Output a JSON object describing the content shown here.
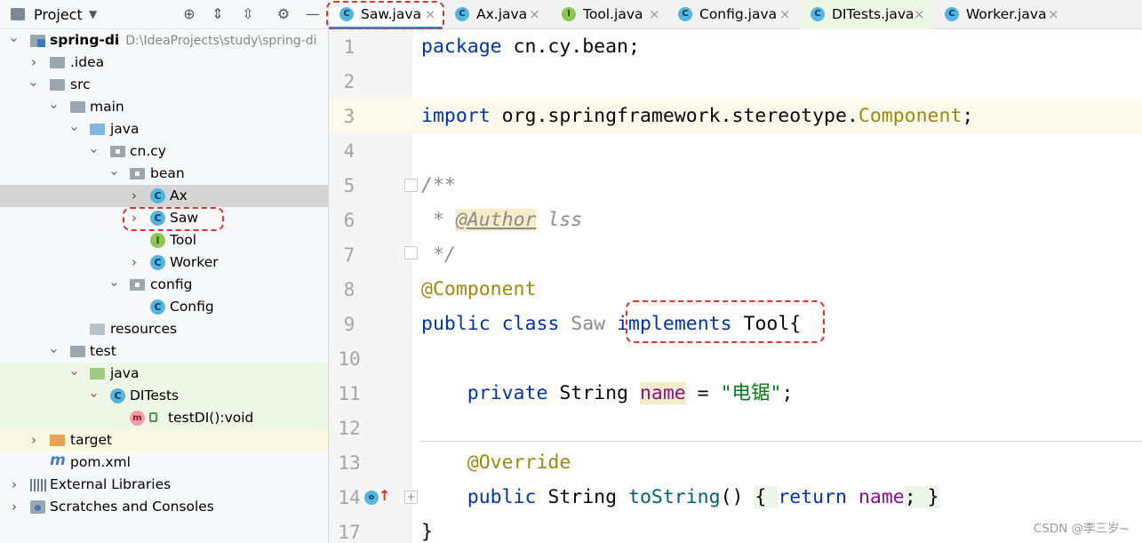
{
  "project_panel": {
    "title": "Project",
    "tree": [
      {
        "label": "spring-di",
        "path": "D:\\IdeaProjects\\study\\spring-di"
      },
      {
        "label": ".idea"
      },
      {
        "label": "src"
      },
      {
        "label": "main"
      },
      {
        "label": "java"
      },
      {
        "label": "cn.cy"
      },
      {
        "label": "bean"
      },
      {
        "label": "Ax"
      },
      {
        "label": "Saw"
      },
      {
        "label": "Tool"
      },
      {
        "label": "Worker"
      },
      {
        "label": "config"
      },
      {
        "label": "Config"
      },
      {
        "label": "resources"
      },
      {
        "label": "test"
      },
      {
        "label": "java"
      },
      {
        "label": "DITests"
      },
      {
        "label": "testDI():void"
      },
      {
        "label": "target"
      },
      {
        "label": "pom.xml"
      },
      {
        "label": "External Libraries"
      },
      {
        "label": "Scratches and Consoles"
      }
    ]
  },
  "tabs": [
    {
      "label": "Saw.java",
      "icon": "C"
    },
    {
      "label": "Ax.java",
      "icon": "C"
    },
    {
      "label": "Tool.java",
      "icon": "I"
    },
    {
      "label": "Config.java",
      "icon": "C"
    },
    {
      "label": "DITests.java",
      "icon": "C"
    },
    {
      "label": "Worker.java",
      "icon": "C"
    }
  ],
  "tab_close_glyph": "×",
  "icons": {
    "class_letter": "C",
    "interface_letter": "I",
    "method_letter": "m",
    "maven_letter": "m"
  },
  "editor": {
    "line_numbers": [
      "1",
      "2",
      "3",
      "4",
      "5",
      "6",
      "7",
      "8",
      "9",
      "10",
      "11",
      "12",
      "13",
      "14",
      "17"
    ],
    "code": {
      "l1_kw": "package",
      "l1_rest": " cn.cy.bean;",
      "l3_kw": "import",
      "l3_pkg": " org.springframework.stereotype.",
      "l3_cls": "Component",
      "l3_end": ";",
      "l5": "/**",
      "l6_star": " * ",
      "l6_tag": "@Author",
      "l6_name": " lss",
      "l7": " */",
      "l8": "@Component",
      "l9_kw": "public class",
      "l9_sp": " ",
      "l9_name": "Saw",
      "l9_sp2": " ",
      "l9_impl": "implements",
      "l9_sp3": " ",
      "l9_iface": "Tool",
      "l9_brace": "{",
      "l11_indent": "    ",
      "l11_kw": "private",
      "l11_type": " String ",
      "l11_field": "name",
      "l11_eq": " = ",
      "l11_str": "\"电锯\"",
      "l11_end": ";",
      "l13_indent": "    ",
      "l13_ann": "@Override",
      "l14_indent": "    ",
      "l14_kw": "public",
      "l14_type": " String ",
      "l14_method": "toString",
      "l14_parens": "() ",
      "l14_open": "{ ",
      "l14_ret": "return",
      "l14_sp": " ",
      "l14_field": "name",
      "l14_semi": ";",
      "l14_close": " }",
      "l17": "}"
    }
  },
  "watermark": "CSDN @李三岁~"
}
